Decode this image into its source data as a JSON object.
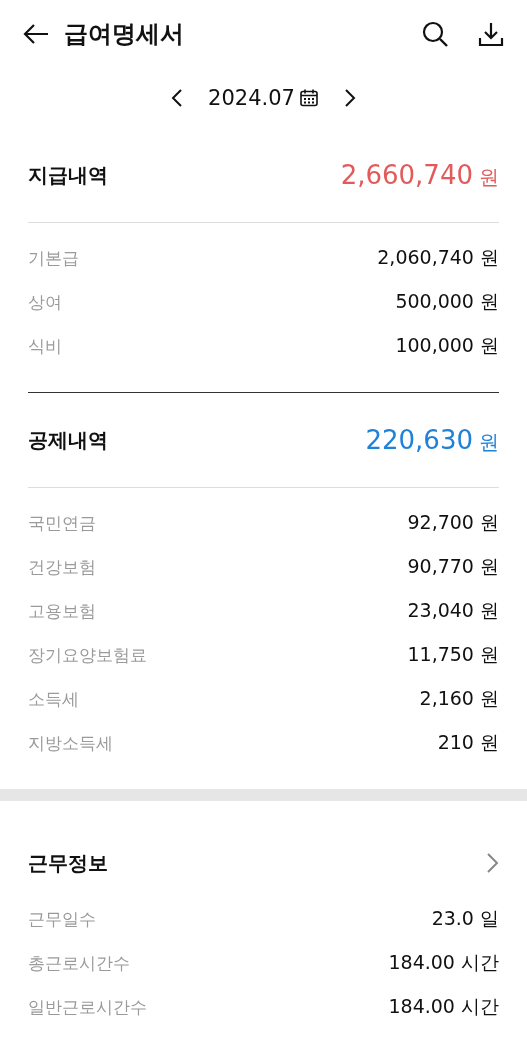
{
  "header": {
    "title": "급여명세서"
  },
  "period": {
    "label": "2024.07"
  },
  "sections": [
    {
      "title": "지급내역",
      "total": "2,660,740",
      "unit": "원",
      "color": "#e25a5a",
      "items": [
        {
          "label": "기본급",
          "value": "2,060,740 원"
        },
        {
          "label": "상여",
          "value": "500,000 원"
        },
        {
          "label": "식비",
          "value": "100,000 원"
        }
      ]
    },
    {
      "title": "공제내역",
      "total": "220,630",
      "unit": "원",
      "color": "#1f82d8",
      "items": [
        {
          "label": "국민연금",
          "value": "92,700 원"
        },
        {
          "label": "건강보험",
          "value": "90,770 원"
        },
        {
          "label": "고용보험",
          "value": "23,040 원"
        },
        {
          "label": "장기요양보험료",
          "value": "11,750 원"
        },
        {
          "label": "소득세",
          "value": "2,160 원"
        },
        {
          "label": "지방소득세",
          "value": "210 원"
        }
      ]
    }
  ],
  "work_info": {
    "title": "근무정보",
    "items": [
      {
        "label": "근무일수",
        "value": "23.0 일"
      },
      {
        "label": "총근로시간수",
        "value": "184.00 시간"
      },
      {
        "label": "일반근로시간수",
        "value": "184.00 시간"
      }
    ]
  }
}
